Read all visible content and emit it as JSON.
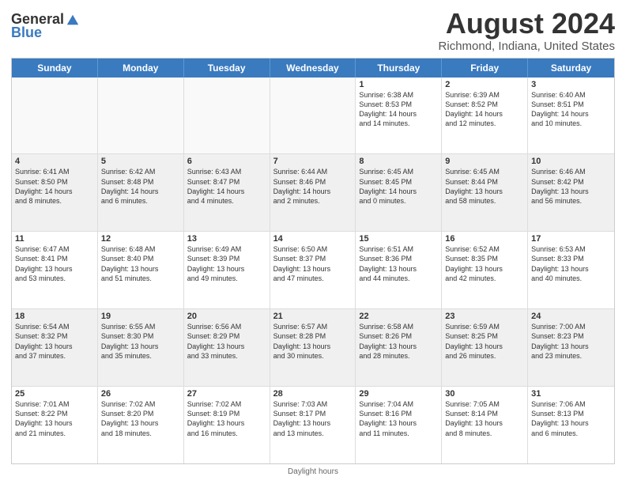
{
  "logo": {
    "general": "General",
    "blue": "Blue"
  },
  "title": "August 2024",
  "subtitle": "Richmond, Indiana, United States",
  "days": [
    "Sunday",
    "Monday",
    "Tuesday",
    "Wednesday",
    "Thursday",
    "Friday",
    "Saturday"
  ],
  "footer": "Daylight hours",
  "weeks": [
    [
      {
        "day": "",
        "info": ""
      },
      {
        "day": "",
        "info": ""
      },
      {
        "day": "",
        "info": ""
      },
      {
        "day": "",
        "info": ""
      },
      {
        "day": "1",
        "info": "Sunrise: 6:38 AM\nSunset: 8:53 PM\nDaylight: 14 hours\nand 14 minutes."
      },
      {
        "day": "2",
        "info": "Sunrise: 6:39 AM\nSunset: 8:52 PM\nDaylight: 14 hours\nand 12 minutes."
      },
      {
        "day": "3",
        "info": "Sunrise: 6:40 AM\nSunset: 8:51 PM\nDaylight: 14 hours\nand 10 minutes."
      }
    ],
    [
      {
        "day": "4",
        "info": "Sunrise: 6:41 AM\nSunset: 8:50 PM\nDaylight: 14 hours\nand 8 minutes."
      },
      {
        "day": "5",
        "info": "Sunrise: 6:42 AM\nSunset: 8:48 PM\nDaylight: 14 hours\nand 6 minutes."
      },
      {
        "day": "6",
        "info": "Sunrise: 6:43 AM\nSunset: 8:47 PM\nDaylight: 14 hours\nand 4 minutes."
      },
      {
        "day": "7",
        "info": "Sunrise: 6:44 AM\nSunset: 8:46 PM\nDaylight: 14 hours\nand 2 minutes."
      },
      {
        "day": "8",
        "info": "Sunrise: 6:45 AM\nSunset: 8:45 PM\nDaylight: 14 hours\nand 0 minutes."
      },
      {
        "day": "9",
        "info": "Sunrise: 6:45 AM\nSunset: 8:44 PM\nDaylight: 13 hours\nand 58 minutes."
      },
      {
        "day": "10",
        "info": "Sunrise: 6:46 AM\nSunset: 8:42 PM\nDaylight: 13 hours\nand 56 minutes."
      }
    ],
    [
      {
        "day": "11",
        "info": "Sunrise: 6:47 AM\nSunset: 8:41 PM\nDaylight: 13 hours\nand 53 minutes."
      },
      {
        "day": "12",
        "info": "Sunrise: 6:48 AM\nSunset: 8:40 PM\nDaylight: 13 hours\nand 51 minutes."
      },
      {
        "day": "13",
        "info": "Sunrise: 6:49 AM\nSunset: 8:39 PM\nDaylight: 13 hours\nand 49 minutes."
      },
      {
        "day": "14",
        "info": "Sunrise: 6:50 AM\nSunset: 8:37 PM\nDaylight: 13 hours\nand 47 minutes."
      },
      {
        "day": "15",
        "info": "Sunrise: 6:51 AM\nSunset: 8:36 PM\nDaylight: 13 hours\nand 44 minutes."
      },
      {
        "day": "16",
        "info": "Sunrise: 6:52 AM\nSunset: 8:35 PM\nDaylight: 13 hours\nand 42 minutes."
      },
      {
        "day": "17",
        "info": "Sunrise: 6:53 AM\nSunset: 8:33 PM\nDaylight: 13 hours\nand 40 minutes."
      }
    ],
    [
      {
        "day": "18",
        "info": "Sunrise: 6:54 AM\nSunset: 8:32 PM\nDaylight: 13 hours\nand 37 minutes."
      },
      {
        "day": "19",
        "info": "Sunrise: 6:55 AM\nSunset: 8:30 PM\nDaylight: 13 hours\nand 35 minutes."
      },
      {
        "day": "20",
        "info": "Sunrise: 6:56 AM\nSunset: 8:29 PM\nDaylight: 13 hours\nand 33 minutes."
      },
      {
        "day": "21",
        "info": "Sunrise: 6:57 AM\nSunset: 8:28 PM\nDaylight: 13 hours\nand 30 minutes."
      },
      {
        "day": "22",
        "info": "Sunrise: 6:58 AM\nSunset: 8:26 PM\nDaylight: 13 hours\nand 28 minutes."
      },
      {
        "day": "23",
        "info": "Sunrise: 6:59 AM\nSunset: 8:25 PM\nDaylight: 13 hours\nand 26 minutes."
      },
      {
        "day": "24",
        "info": "Sunrise: 7:00 AM\nSunset: 8:23 PM\nDaylight: 13 hours\nand 23 minutes."
      }
    ],
    [
      {
        "day": "25",
        "info": "Sunrise: 7:01 AM\nSunset: 8:22 PM\nDaylight: 13 hours\nand 21 minutes."
      },
      {
        "day": "26",
        "info": "Sunrise: 7:02 AM\nSunset: 8:20 PM\nDaylight: 13 hours\nand 18 minutes."
      },
      {
        "day": "27",
        "info": "Sunrise: 7:02 AM\nSunset: 8:19 PM\nDaylight: 13 hours\nand 16 minutes."
      },
      {
        "day": "28",
        "info": "Sunrise: 7:03 AM\nSunset: 8:17 PM\nDaylight: 13 hours\nand 13 minutes."
      },
      {
        "day": "29",
        "info": "Sunrise: 7:04 AM\nSunset: 8:16 PM\nDaylight: 13 hours\nand 11 minutes."
      },
      {
        "day": "30",
        "info": "Sunrise: 7:05 AM\nSunset: 8:14 PM\nDaylight: 13 hours\nand 8 minutes."
      },
      {
        "day": "31",
        "info": "Sunrise: 7:06 AM\nSunset: 8:13 PM\nDaylight: 13 hours\nand 6 minutes."
      }
    ]
  ]
}
